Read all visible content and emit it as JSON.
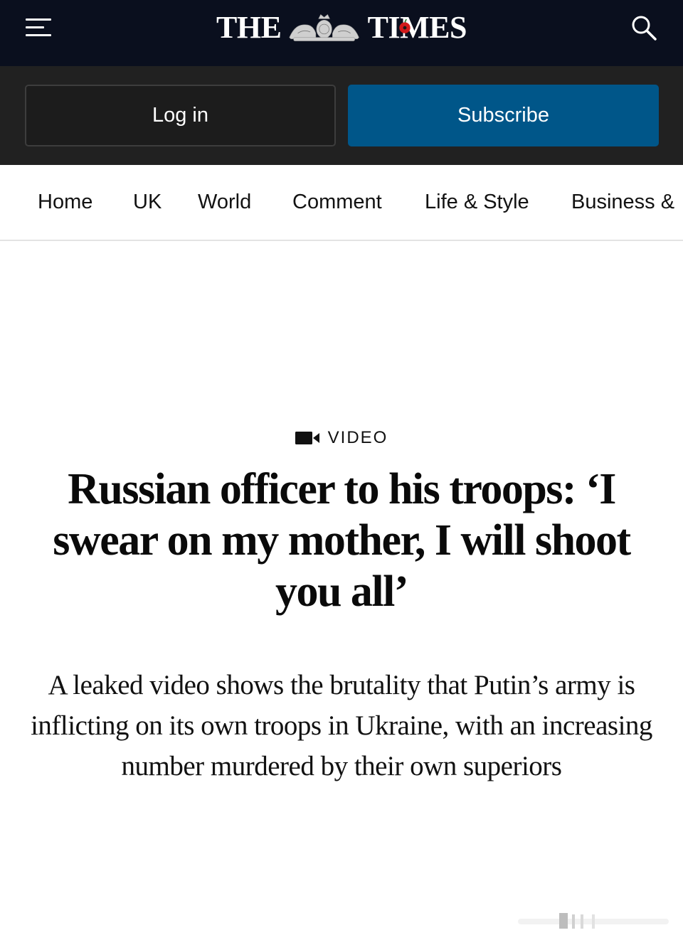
{
  "header": {
    "masthead_left": "THE",
    "masthead_right": "TIMES",
    "menu_icon": "hamburger-menu-icon",
    "search_icon": "search-icon",
    "background_color": "#0a0f1e"
  },
  "auth": {
    "login_label": "Log in",
    "subscribe_label": "Subscribe",
    "subscribe_color": "#005689"
  },
  "nav": {
    "items": [
      "Home",
      "UK",
      "World",
      "Comment",
      "Life & Style",
      "Business &"
    ]
  },
  "article": {
    "kicker_icon": "video-camera-icon",
    "kicker": "VIDEO",
    "headline": "Russian officer to his troops: ‘I swear on my mother, I will shoot you all’",
    "standfirst": "A leaked video shows the brutality that Putin’s army is inflicting on its own troops in Ukraine, with an increasing number murdered by their own superiors"
  }
}
